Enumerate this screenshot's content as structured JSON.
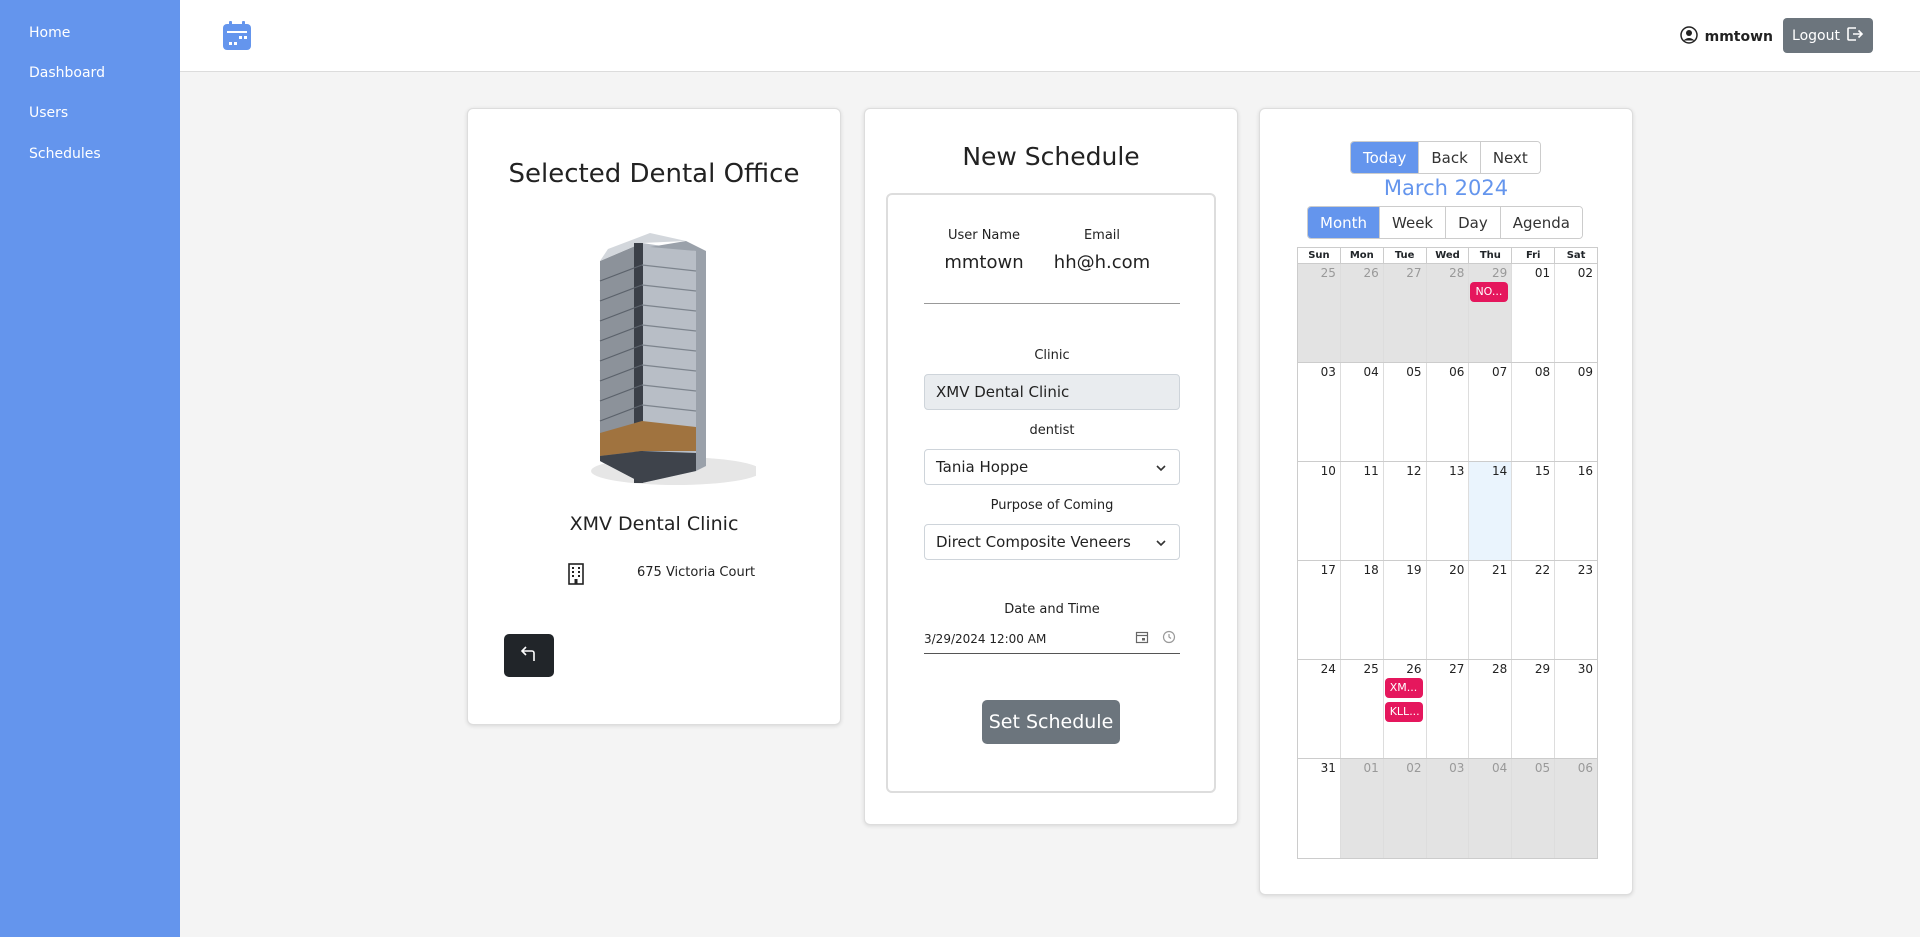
{
  "sidebar": {
    "items": [
      {
        "label": "Home"
      },
      {
        "label": "Dashboard"
      },
      {
        "label": "Users"
      },
      {
        "label": "Schedules"
      }
    ]
  },
  "header": {
    "username": "mmtown",
    "logout_label": "Logout"
  },
  "office": {
    "title": "Selected Dental Office",
    "clinic_name": "XMV Dental Clinic",
    "address": "675 Victoria Court"
  },
  "schedule": {
    "title": "New Schedule",
    "user_name_label": "User Name",
    "user_name": "mmtown",
    "email_label": "Email",
    "email": "hh@h.com",
    "clinic_label": "Clinic",
    "clinic_value": "XMV Dental Clinic",
    "dentist_label": "dentist",
    "dentist_value": "Tania Hoppe",
    "purpose_label": "Purpose of Coming",
    "purpose_value": "Direct Composite Veneers",
    "datetime_label": "Date and Time",
    "datetime_value": "3/29/2024 12:00 AM",
    "submit_label": "Set Schedule"
  },
  "calendar": {
    "nav": [
      "Today",
      "Back",
      "Next"
    ],
    "month_label": "March 2024",
    "views": [
      "Month",
      "Week",
      "Day",
      "Agenda"
    ],
    "active_view": "Month",
    "days_of_week": [
      "Sun",
      "Mon",
      "Tue",
      "Wed",
      "Thu",
      "Fri",
      "Sat"
    ],
    "weeks": [
      [
        {
          "d": "25",
          "off": true
        },
        {
          "d": "26",
          "off": true
        },
        {
          "d": "27",
          "off": true
        },
        {
          "d": "28",
          "off": true
        },
        {
          "d": "29",
          "off": true,
          "events": [
            "NO..."
          ]
        },
        {
          "d": "01"
        },
        {
          "d": "02"
        }
      ],
      [
        {
          "d": "03"
        },
        {
          "d": "04"
        },
        {
          "d": "05"
        },
        {
          "d": "06"
        },
        {
          "d": "07"
        },
        {
          "d": "08"
        },
        {
          "d": "09"
        }
      ],
      [
        {
          "d": "10"
        },
        {
          "d": "11"
        },
        {
          "d": "12"
        },
        {
          "d": "13"
        },
        {
          "d": "14",
          "today": true
        },
        {
          "d": "15"
        },
        {
          "d": "16"
        }
      ],
      [
        {
          "d": "17"
        },
        {
          "d": "18"
        },
        {
          "d": "19"
        },
        {
          "d": "20"
        },
        {
          "d": "21"
        },
        {
          "d": "22"
        },
        {
          "d": "23"
        }
      ],
      [
        {
          "d": "24"
        },
        {
          "d": "25"
        },
        {
          "d": "26",
          "events": [
            "XM...",
            "KLL..."
          ]
        },
        {
          "d": "27"
        },
        {
          "d": "28"
        },
        {
          "d": "29"
        },
        {
          "d": "30"
        }
      ],
      [
        {
          "d": "31"
        },
        {
          "d": "01",
          "off": true
        },
        {
          "d": "02",
          "off": true
        },
        {
          "d": "03",
          "off": true
        },
        {
          "d": "04",
          "off": true
        },
        {
          "d": "05",
          "off": true
        },
        {
          "d": "06",
          "off": true
        }
      ]
    ],
    "event_color": "#e5175d",
    "accent_color": "#6495ed"
  }
}
